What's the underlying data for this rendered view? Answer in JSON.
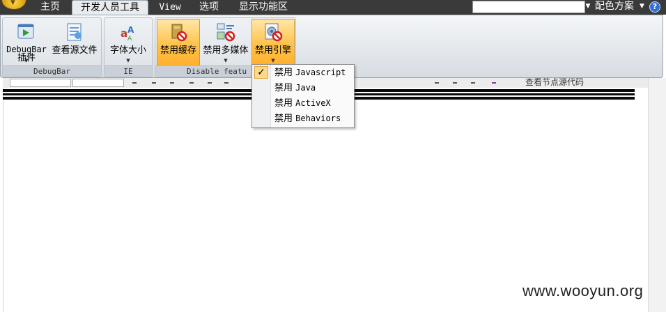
{
  "tabs": [
    "主页",
    "开发人员工具",
    "View",
    "选项",
    "显示功能区"
  ],
  "color_scheme": "配色方案",
  "groups": {
    "debugbar": {
      "label": "DebugBar",
      "buttons": [
        "DebugBar\n插件",
        "查看源文件"
      ]
    },
    "ie": {
      "label": "IE",
      "buttons": [
        "字体大小"
      ]
    },
    "disable": {
      "label": "Disable featu",
      "buttons": [
        "禁用缓存",
        "禁用多媒体",
        "禁用引擎"
      ]
    }
  },
  "engine_menu": {
    "items": [
      {
        "prefix": "禁用",
        "name": "Javascript",
        "checked": true
      },
      {
        "prefix": "禁用",
        "name": "Java",
        "checked": false
      },
      {
        "prefix": "禁用",
        "name": "ActiveX",
        "checked": false
      },
      {
        "prefix": "禁用",
        "name": "Behaviors",
        "checked": false
      }
    ]
  },
  "checkmark": "✓",
  "toolbar_text": "查看节点源代码",
  "watermark": "www.wooyun.org",
  "icons": [
    "app-orb-icon",
    "help-icon",
    "debugbar-plugin-icon",
    "view-source-icon",
    "font-size-icon",
    "disable-cache-icon",
    "disable-media-icon",
    "disable-engine-icon"
  ],
  "colors": {
    "tabbar": "#3a3a3a",
    "highlight": "#ffc24a",
    "check_bg": "#ffd98a"
  }
}
